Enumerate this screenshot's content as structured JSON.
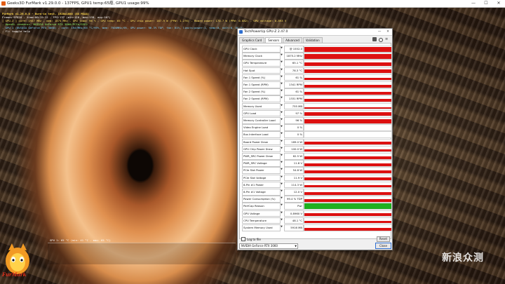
{
  "furmark": {
    "window_title": "Geeks3D FurMark v1.29.0.0 - 137FPS, GPU1 temp:65癈, GPU1 usage:99%",
    "overlay_lines": [
      "FurMark v1.29.0.0 - Burn-in test, 1920x1080 (8X MSAA)",
      "Frames:97816 - time:00:15:12 - FPS:137 (min:110, max:139, avg:107)",
      "[ GPU-Z ] core: 1947 MHz - mem: 1875 MHz - GPU load: 96 % - GPU temp: 65 °C - GPU chip power: 167.9 W (PPW: 1.276) - Board power: 170.7 W (PPW: 0.882) - GPU voltage: 0.893 V",
      "- OpenGL renderer: NVIDIA GeForce RTX 3060/PCIe/SSE2",
      "- GPU 1 (NVIDIA GeForce RTX 3060) - core: 1947MHz/65 °C/99%, mem: 7500MHz/6%, GPU power: 96.3% TDP, fan: 61%, limits(power:1, temp:0, volt:0, OV:0)",
      "- F1: toggle help"
    ],
    "graph_label": "GPU 1: 65 °C (min: 41 °C - max: 65 °C)",
    "logo_text": "FurMark"
  },
  "watermark_text": "新浪众测",
  "gpuz": {
    "title": "TechPowerUp GPU-Z 2.47.0",
    "tabs": [
      "Graphics Card",
      "Sensors",
      "Advanced",
      "Validation"
    ],
    "active_tab": "Sensors",
    "menu_glyph": "≡",
    "sensors": [
      {
        "label": "GPU Clock",
        "value": "@ 1552.0",
        "level": 0.85,
        "color": "#dd1010"
      },
      {
        "label": "Memory Clock",
        "value": "1875.2 MHz",
        "level": 0.85,
        "color": "#dd1010"
      },
      {
        "label": "GPU Temperature",
        "value": "65.1 °C",
        "level": 0.65,
        "color": "#dd1010"
      },
      {
        "label": "Hot Spot",
        "value": "78.3 °C",
        "level": 0.65,
        "color": "#dd1010"
      },
      {
        "label": "Fan 1 Speed (%)",
        "value": "61 %",
        "level": 0.5,
        "color": "#dd1010"
      },
      {
        "label": "Fan 1 Speed (RPM)",
        "value": "1341 RPM",
        "level": 0.5,
        "color": "#dd1010"
      },
      {
        "label": "Fan 2 Speed (%)",
        "value": "61 %",
        "level": 0.5,
        "color": "#dd1010"
      },
      {
        "label": "Fan 2 Speed (RPM)",
        "value": "1331 RPM",
        "level": 0.5,
        "color": "#dd1010"
      },
      {
        "label": "Memory Used",
        "value": "755 MB",
        "level": 0.25,
        "color": "#dd1010"
      },
      {
        "label": "GPU Load",
        "value": "97 %",
        "level": 0.75,
        "color": "#dd1010"
      },
      {
        "label": "Memory Controller Load",
        "value": "96 %",
        "level": 0.75,
        "color": "#dd1010"
      },
      {
        "label": "Video Engine Load",
        "value": "0 %",
        "level": 0.0,
        "color": "#dd1010"
      },
      {
        "label": "Bus Interface Load",
        "value": "0 %",
        "level": 0.0,
        "color": "#dd1010"
      },
      {
        "label": "Board Power Draw",
        "value": "169.0 W",
        "level": 0.5,
        "color": "#dd1010"
      },
      {
        "label": "GPU Chip Power Draw",
        "value": "100.0 W",
        "level": 0.5,
        "color": "#dd1010"
      },
      {
        "label": "PWR_SRC Power Draw",
        "value": "62.5 W",
        "level": 0.5,
        "color": "#dd1010"
      },
      {
        "label": "PWR_SRC Voltage",
        "value": "11.8 V",
        "level": 0.5,
        "color": "#dd1010"
      },
      {
        "label": "PCIe Slot Power",
        "value": "54.8 W",
        "level": 0.5,
        "color": "#dd1010"
      },
      {
        "label": "PCIe Slot Voltage",
        "value": "11.9 V",
        "level": 0.5,
        "color": "#dd1010"
      },
      {
        "label": "8-Pin #1 Power",
        "value": "114.3 W",
        "level": 0.5,
        "color": "#dd1010"
      },
      {
        "label": "8-Pin #1 Voltage",
        "value": "12.0 V",
        "level": 0.5,
        "color": "#dd1010"
      },
      {
        "label": "Power Consumption (%)",
        "value": "99.4 % TDP",
        "level": 0.5,
        "color": "#dd1010"
      },
      {
        "label": "PerfCap Reason",
        "value": "Pwr",
        "level": 1.0,
        "color": "#1fb01f"
      },
      {
        "label": "GPU Voltage",
        "value": "0.8960 V",
        "level": 0.5,
        "color": "#dd1010"
      },
      {
        "label": "CPU Temperature",
        "value": "48.1 °C",
        "level": 0.5,
        "color": "#dd1010"
      },
      {
        "label": "System Memory Used",
        "value": "5916 MB",
        "level": 0.5,
        "color": "#dd1010"
      }
    ],
    "log_label": "Log to file",
    "reset_label": "Reset",
    "device": "NVIDIA GeForce RTX 3060",
    "close_label": "Close"
  }
}
